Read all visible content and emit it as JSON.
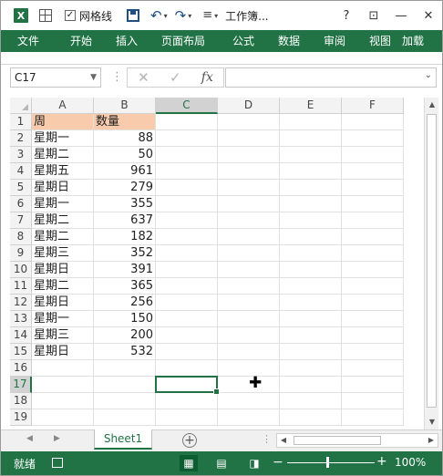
{
  "titlebar": {
    "app_icon": "X",
    "gridlines_label": "网格线",
    "gridlines_checked": "✓",
    "title": "工作簿...",
    "help": "?",
    "restore": "⊡",
    "minimize": "—",
    "close": "✕"
  },
  "ribbon": {
    "tabs": [
      "文件",
      "开始",
      "插入",
      "页面布局",
      "公式",
      "数据",
      "审阅",
      "视图",
      "加载"
    ]
  },
  "formula_bar": {
    "name_box": "C17",
    "fx": "fx",
    "cancel": "✕",
    "enter": "✓",
    "value": ""
  },
  "sheet": {
    "columns": [
      "A",
      "B",
      "C",
      "D",
      "E",
      "F"
    ],
    "selected_col": "C",
    "selected_row": "17",
    "rows": [
      {
        "num": "1",
        "a": "周",
        "b": "数量"
      },
      {
        "num": "2",
        "a": "星期一",
        "b": "88"
      },
      {
        "num": "3",
        "a": "星期二",
        "b": "50"
      },
      {
        "num": "4",
        "a": "星期五",
        "b": "961"
      },
      {
        "num": "5",
        "a": "星期日",
        "b": "279"
      },
      {
        "num": "6",
        "a": "星期一",
        "b": "355"
      },
      {
        "num": "7",
        "a": "星期二",
        "b": "637"
      },
      {
        "num": "8",
        "a": "星期二",
        "b": "182"
      },
      {
        "num": "9",
        "a": "星期三",
        "b": "352"
      },
      {
        "num": "10",
        "a": "星期日",
        "b": "391"
      },
      {
        "num": "11",
        "a": "星期二",
        "b": "365"
      },
      {
        "num": "12",
        "a": "星期日",
        "b": "256"
      },
      {
        "num": "13",
        "a": "星期一",
        "b": "150"
      },
      {
        "num": "14",
        "a": "星期三",
        "b": "200"
      },
      {
        "num": "15",
        "a": "星期日",
        "b": "532"
      },
      {
        "num": "16",
        "a": "",
        "b": ""
      },
      {
        "num": "17",
        "a": "",
        "b": ""
      },
      {
        "num": "18",
        "a": "",
        "b": ""
      },
      {
        "num": "19",
        "a": "",
        "b": ""
      }
    ],
    "header_fill": "#f8cbad"
  },
  "sheet_tabs": {
    "tabs": [
      "Sheet1"
    ],
    "add": "+"
  },
  "status_bar": {
    "ready": "就绪",
    "zoom": "100%",
    "zoom_minus": "−",
    "zoom_plus": "+"
  },
  "colors": {
    "accent": "#217346"
  }
}
